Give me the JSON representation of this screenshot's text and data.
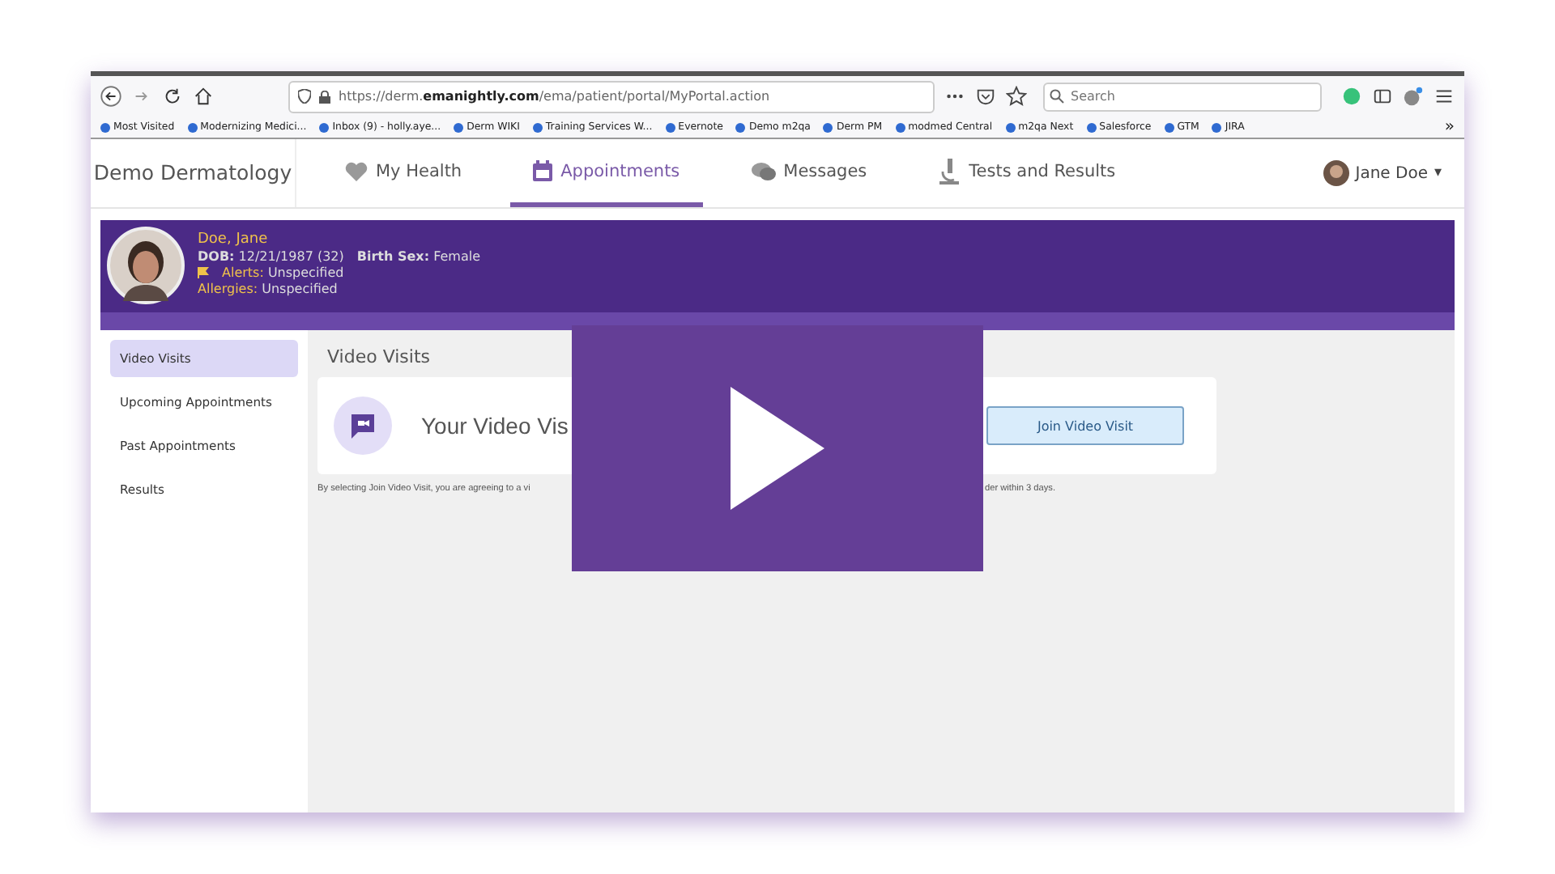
{
  "browser": {
    "url_prefix": "https://derm.",
    "url_domain": "emanightly.com",
    "url_path": "/ema/patient/portal/MyPortal.action",
    "search_placeholder": "Search",
    "bookmarks": [
      "Most Visited",
      "Modernizing Medici...",
      "Inbox (9) - holly.aye...",
      "Derm WIKI",
      "Training Services W...",
      "Evernote",
      "Demo m2qa",
      "Derm PM",
      "modmed Central",
      "m2qa Next",
      "Salesforce",
      "GTM",
      "JIRA"
    ],
    "overflow": "»"
  },
  "portal": {
    "brand": "Demo Dermatology",
    "tabs": [
      {
        "label": "My Health",
        "kind": "heart",
        "selected": false
      },
      {
        "label": "Appointments",
        "kind": "calendar",
        "selected": true
      },
      {
        "label": "Messages",
        "kind": "chat",
        "selected": false
      },
      {
        "label": "Tests and Results",
        "kind": "microscope",
        "selected": false
      }
    ],
    "user": "Jane Doe",
    "user_caret": "▾"
  },
  "patient": {
    "name": "Doe, Jane",
    "fields": [
      {
        "label": "DOB:",
        "value": "12/21/1987 (32)"
      },
      {
        "label": "Birth Sex:",
        "value": "Female"
      }
    ],
    "alerts": {
      "label": "Alerts:",
      "value": "Unspecified"
    },
    "allergies": {
      "label": "Allergies:",
      "value": "Unspecified"
    }
  },
  "sidebar": [
    {
      "label": "Video Visits",
      "selected": true
    },
    {
      "label": "Upcoming Appointments",
      "selected": false
    },
    {
      "label": "Past Appointments",
      "selected": false
    },
    {
      "label": "Results",
      "selected": false
    }
  ],
  "main": {
    "title": "Video Visits",
    "message": "Your Video Vis",
    "button": "Join Video Visit",
    "disclaimer": "By selecting Join Video Visit, you are agreeing to a vi",
    "disclaimer_end": "der within 3 days."
  },
  "player": {
    "playing": false
  }
}
